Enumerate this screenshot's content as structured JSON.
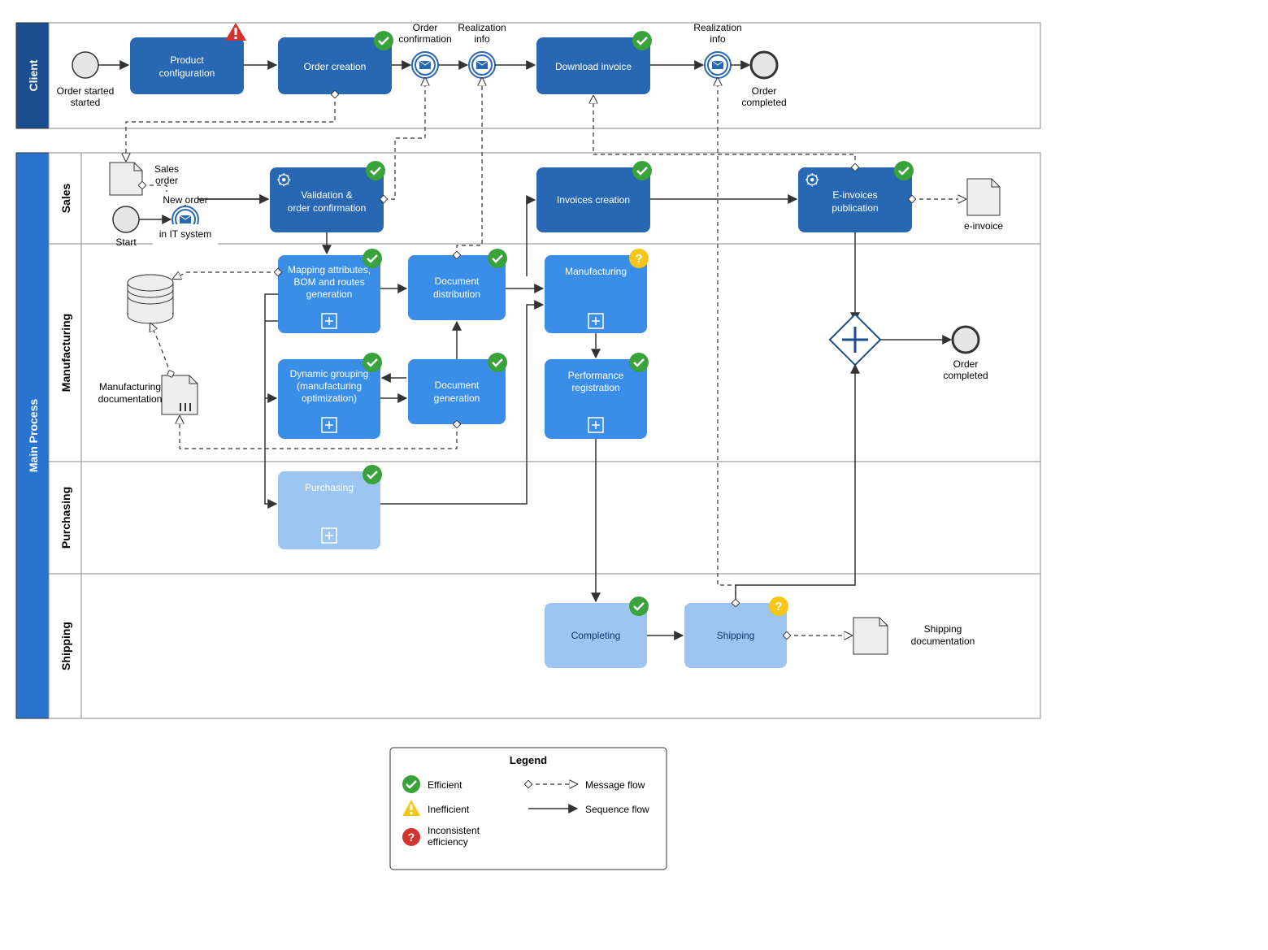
{
  "pools": {
    "client": {
      "title": "Client"
    },
    "main": {
      "title": "Main Process"
    }
  },
  "lanes": {
    "sales": {
      "title": "Sales"
    },
    "manufacturing": {
      "title": "Manufacturing"
    },
    "purchasing": {
      "title": "Purchasing"
    },
    "shipping": {
      "title": "Shipping"
    }
  },
  "client": {
    "start_label": "Order\nstarted",
    "task_config_l1": "Product",
    "task_config_l2": "configuration",
    "task_order_creation": "Order creation",
    "msg_order_conf_l1": "Order",
    "msg_order_conf_l2": "confirmation",
    "msg_realization_l1": "Realization",
    "msg_realization_l2": "info",
    "task_download_invoice": "Download invoice",
    "msg_realization2_l1": "Realization",
    "msg_realization2_l2": "info",
    "end_label_l1": "Order",
    "end_label_l2": "completed"
  },
  "sales": {
    "doc_sales_order_l1": "Sales",
    "doc_sales_order_l2": "order",
    "start_label": "Start",
    "msg_new_order_l1": "New order",
    "msg_new_order_l2": "in IT system",
    "task_validation_l1": "Validation &",
    "task_validation_l2": "order confirmation",
    "task_invoices": "Invoices creation",
    "task_einvoices_l1": "E-invoices",
    "task_einvoices_l2": "publication",
    "doc_einvoice": "e-invoice"
  },
  "manufacturing": {
    "doc_manuf_l1": "Manufacturing",
    "doc_manuf_l2": "documentation",
    "task_mapping_l1": "Mapping attributes,",
    "task_mapping_l2": "BOM and routes",
    "task_mapping_l3": "generation",
    "task_dyn_l1": "Dynamic grouping",
    "task_dyn_l2": "(manufacturing",
    "task_dyn_l3": "optimization)",
    "task_docdist_l1": "Document",
    "task_docdist_l2": "distribution",
    "task_docgen_l1": "Document",
    "task_docgen_l2": "generation",
    "task_manuf": "Manufacturing",
    "task_perf_l1": "Performance",
    "task_perf_l2": "registration"
  },
  "purchasing": {
    "task_purchasing": "Purchasing"
  },
  "shipping": {
    "task_completing": "Completing",
    "task_shipping": "Shipping",
    "doc_ship_l1": "Shipping",
    "doc_ship_l2": "documentation"
  },
  "main_end_l1": "Order",
  "main_end_l2": "completed",
  "legend": {
    "title": "Legend",
    "efficient": "Efficient",
    "inefficient": "Inefficient",
    "inconsistent_l1": "Inconsistent",
    "inconsistent_l2": "efficiency",
    "message_flow": "Message flow",
    "sequence_flow": "Sequence flow"
  },
  "colors": {
    "pool_client": "#1a4e8e",
    "pool_main": "#2a74d0",
    "task_dark": "#2868b3",
    "task_mid": "#3a8ee8",
    "task_light": "#9cc5ef",
    "badge_green": "#3aa23a",
    "badge_yellow": "#f5c518",
    "badge_red": "#d1332e",
    "stroke": "#333333"
  }
}
